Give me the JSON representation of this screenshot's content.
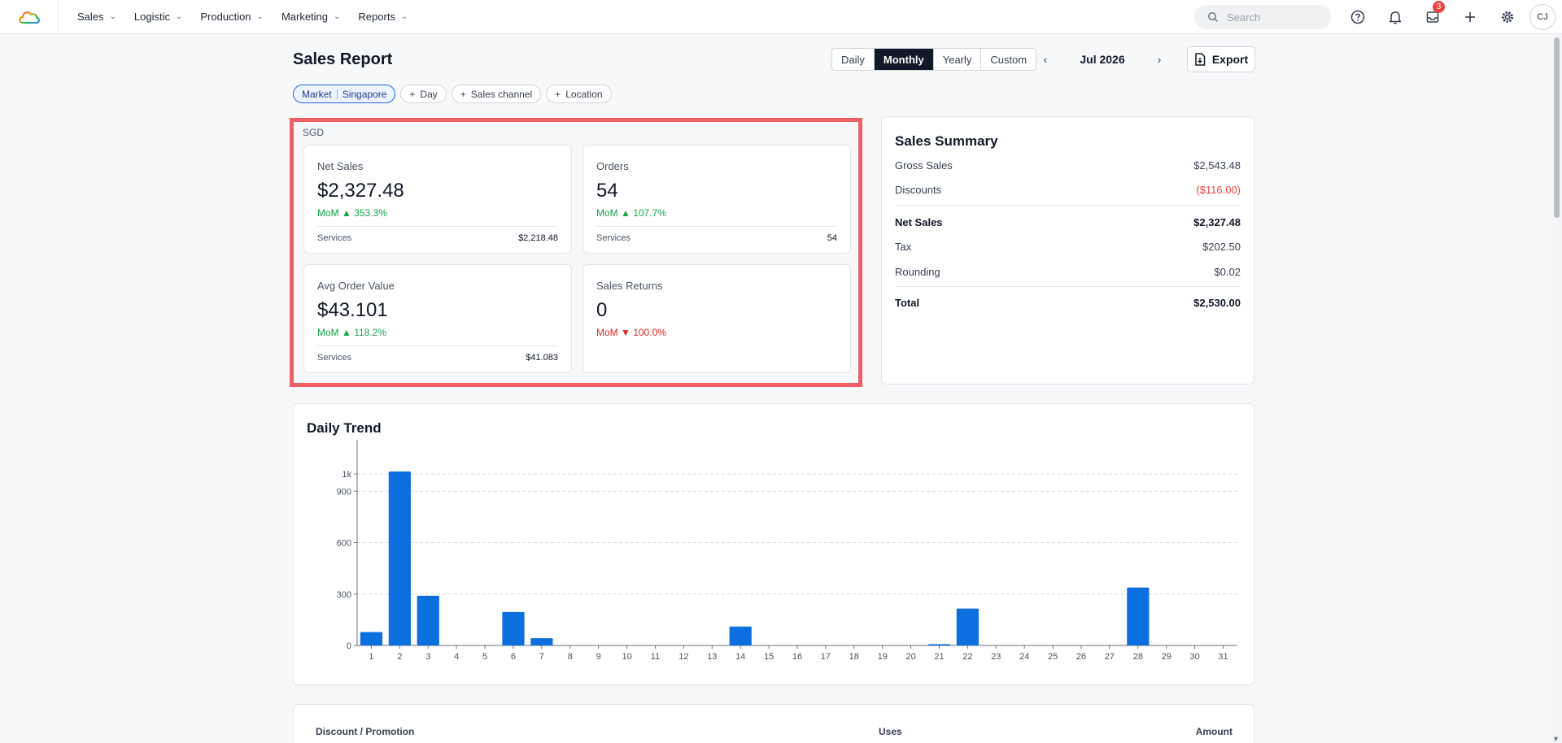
{
  "nav": {
    "items": [
      {
        "label": "Sales"
      },
      {
        "label": "Logistic"
      },
      {
        "label": "Production"
      },
      {
        "label": "Marketing"
      },
      {
        "label": "Reports"
      }
    ],
    "search_placeholder": "Search",
    "inbox_badge": "3",
    "avatar_initials": "CJ"
  },
  "header": {
    "title": "Sales Report",
    "periods": [
      "Daily",
      "Monthly",
      "Yearly",
      "Custom"
    ],
    "active_period": "Monthly",
    "date_label": "Jul 2026",
    "export_label": "Export"
  },
  "filters": {
    "market_key": "Market",
    "market_value": "Singapore",
    "add_day": "Day",
    "add_channel": "Sales channel",
    "add_location": "Location"
  },
  "metrics": {
    "currency": "SGD",
    "net_sales": {
      "label": "Net Sales",
      "value": "$2,327.48",
      "change": "MoM ▲ 353.3%",
      "direction": "up",
      "sub_label": "Services",
      "sub_value": "$2,218.48"
    },
    "orders": {
      "label": "Orders",
      "value": "54",
      "change": "MoM ▲ 107.7%",
      "direction": "up",
      "sub_label": "Services",
      "sub_value": "54"
    },
    "avg_order": {
      "label": "Avg Order Value",
      "value": "$43.101",
      "change": "MoM ▲ 118.2%",
      "direction": "up",
      "sub_label": "Services",
      "sub_value": "$41.083"
    },
    "returns": {
      "label": "Sales Returns",
      "value": "0",
      "change": "MoM ▼ 100.0%",
      "direction": "down"
    }
  },
  "summary": {
    "title": "Sales Summary",
    "gross_sales": {
      "label": "Gross Sales",
      "value": "$2,543.48"
    },
    "discounts": {
      "label": "Discounts",
      "value": "($116.00)"
    },
    "net_sales": {
      "label": "Net Sales",
      "value": "$2,327.48"
    },
    "tax": {
      "label": "Tax",
      "value": "$202.50"
    },
    "rounding": {
      "label": "Rounding",
      "value": "$0.02"
    },
    "total": {
      "label": "Total",
      "value": "$2,530.00"
    }
  },
  "chart_data": {
    "type": "bar",
    "title": "Daily Trend",
    "categories": [
      "1",
      "2",
      "3",
      "4",
      "5",
      "6",
      "7",
      "8",
      "9",
      "10",
      "11",
      "12",
      "13",
      "14",
      "15",
      "16",
      "17",
      "18",
      "19",
      "20",
      "21",
      "22",
      "23",
      "24",
      "25",
      "26",
      "27",
      "28",
      "29",
      "30",
      "31"
    ],
    "values": [
      78,
      1015,
      290,
      0,
      0,
      195,
      42,
      0,
      0,
      0,
      0,
      0,
      0,
      110,
      0,
      0,
      0,
      0,
      0,
      0,
      8,
      215,
      0,
      0,
      0,
      0,
      0,
      338,
      0,
      0,
      0
    ],
    "yticks": [
      0,
      300,
      600,
      900,
      1000
    ],
    "ytick_labels": [
      "0",
      "300",
      "600",
      "900",
      "1k"
    ],
    "ylim": [
      0,
      1200
    ],
    "grid": true,
    "bar_color": "#0b6fe0"
  },
  "discounts": {
    "col_name": "Discount / Promotion",
    "col_uses": "Uses",
    "col_amount": "Amount"
  }
}
